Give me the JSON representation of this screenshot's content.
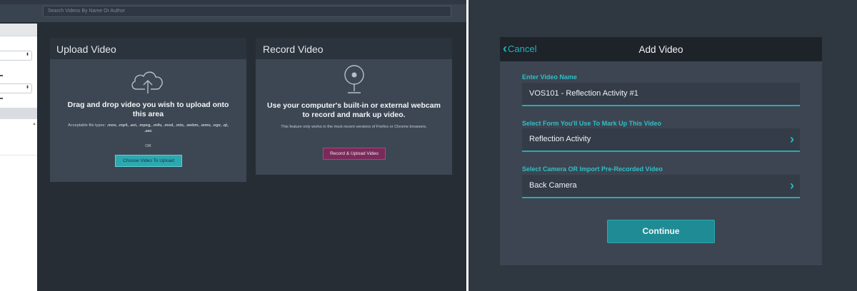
{
  "left_screen": {
    "search_placeholder": "Search Videos By Name Or Author",
    "upload_card": {
      "title": "Upload Video",
      "icon": "cloud-upload-icon",
      "heading": "Drag and drop video you wish to upload onto this area",
      "filetypes_prefix": "Acceptable file types: ",
      "filetypes": ".mov, .mp4, .avi, .mpeg, .m4v, .mod, .mts, .webm, .wmv, .ogv, .qt, .aac",
      "or_text": "OR",
      "button_label": "Choose Video To Upload"
    },
    "record_card": {
      "title": "Record Video",
      "icon": "webcam-icon",
      "heading": "Use your computer's built-in or external webcam to record and mark up video.",
      "note": "This feature only works in the most recent versions of Firefox or Chrome browsers.",
      "button_label": "Record & Upload Video"
    },
    "sidebar_fragment": {
      "dropdown_1_arrow": "⬍",
      "dropdown_2_arrow": "⬍"
    }
  },
  "right_screen": {
    "nav": {
      "cancel_label": "Cancel",
      "title": "Add Video"
    },
    "fields": [
      {
        "label": "Enter Video Name",
        "value": "VOS101 - Reflection Activity #1"
      },
      {
        "label": "Select Form You'll Use To Mark Up This Video",
        "value": "Reflection Activity"
      },
      {
        "label": "Select Camera OR Import Pre-Recorded Video",
        "value": "Back Camera"
      }
    ],
    "continue_label": "Continue"
  },
  "colors": {
    "accent_teal": "#2aa9b2",
    "record_button": "#7a2a5a",
    "upload_button": "#2ea8b0"
  }
}
